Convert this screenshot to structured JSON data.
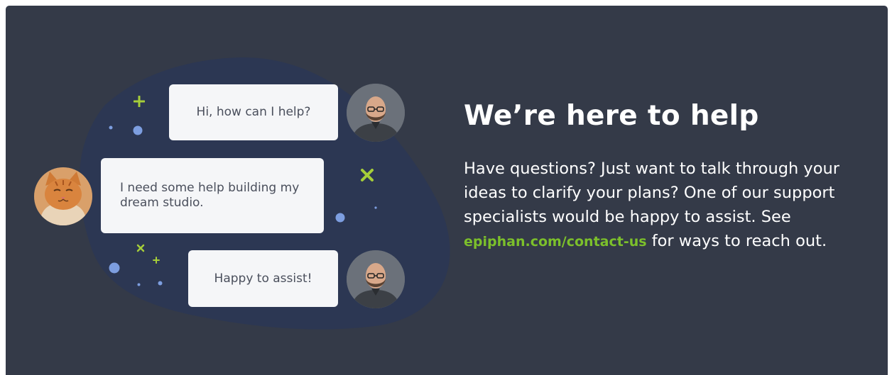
{
  "colors": {
    "panel_bg": "#343a48",
    "blob": "#2c3753",
    "bubble_bg": "#f5f6f8",
    "accent_green": "#a6ce39",
    "link_green": "#7cc02b",
    "dot_blue": "#7d9ee0"
  },
  "chat": {
    "messages": [
      {
        "text": "Hi, how can I help?",
        "sender": "support-specialist"
      },
      {
        "text": "I need some help building my dream studio.",
        "sender": "cat-user"
      },
      {
        "text": "Happy to assist!",
        "sender": "support-specialist"
      }
    ]
  },
  "help": {
    "title": "We’re here to help",
    "body_before": "Have questions? Just want to talk through your ideas to clarify your plans? One of our support specialists would be happy to assist. See ",
    "link_text": "epiphan.com/contact-us",
    "body_after": " for ways to reach out."
  }
}
